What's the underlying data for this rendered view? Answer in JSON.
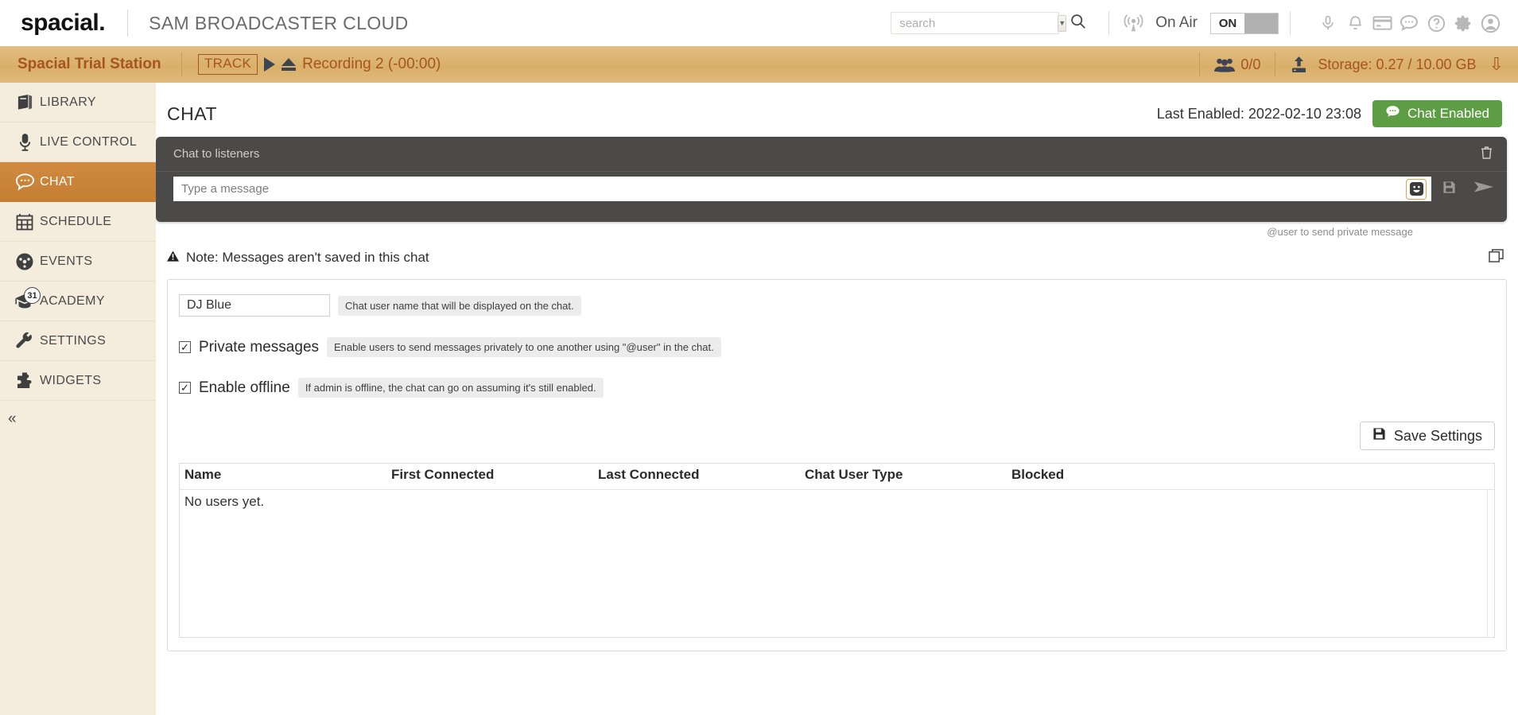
{
  "header": {
    "brand": "spacial",
    "brand_dot": ".",
    "product": "SAM BROADCASTER CLOUD",
    "search": {
      "value": "",
      "placeholder": "search"
    },
    "search_caret_icon": "chevron-down-icon",
    "search_icon": "search-icon",
    "onair": {
      "icon": "broadcast-tower-icon",
      "label": "On Air",
      "state": "ON"
    },
    "icons": [
      "microphone-icon",
      "bell-icon",
      "credit-card-icon",
      "chat-bubble-icon",
      "question-circle-icon",
      "gear-icon",
      "user-circle-icon"
    ]
  },
  "station_bar": {
    "station_name": "Spacial Trial Station",
    "track_tag": "TRACK",
    "track_title": "Recording 2 (-00:00)",
    "listeners": "0/0",
    "storage": "Storage: 0.27 / 10.00 GB",
    "expand_icon": "chevron-double-down-icon"
  },
  "sidebar": {
    "items": [
      {
        "label": "LIBRARY",
        "icon": "book-icon",
        "active": false
      },
      {
        "label": "LIVE CONTROL",
        "icon": "microphone-icon",
        "active": false
      },
      {
        "label": "CHAT",
        "icon": "chat-bubble-icon",
        "active": true
      },
      {
        "label": "SCHEDULE",
        "icon": "calendar-icon",
        "active": false
      },
      {
        "label": "EVENTS",
        "icon": "gauge-icon",
        "active": false
      },
      {
        "label": "ACADEMY",
        "icon": "graduation-cap-icon",
        "active": false,
        "badge": "31"
      },
      {
        "label": "SETTINGS",
        "icon": "wrench-icon",
        "active": false
      },
      {
        "label": "WIDGETS",
        "icon": "puzzle-icon",
        "active": false
      }
    ],
    "collapse_icon": "chevron-double-left-icon"
  },
  "main": {
    "page_title": "CHAT",
    "last_enabled": "Last Enabled: 2022-02-10 23:08",
    "chat_enabled_button": "Chat Enabled",
    "chat_enabled_icon": "chat-bubble-icon",
    "chat_enabled_color": "#5d9e45",
    "chat_panel": {
      "title": "Chat to listeners",
      "trash_icon": "trash-icon",
      "input_value": "",
      "input_placeholder": "Type a message",
      "emoji_icon": "smiley-icon",
      "save_icon": "floppy-disk-icon",
      "send_icon": "send-icon",
      "hint": "@user to send private message"
    },
    "note": "Note: Messages aren't saved in this chat",
    "note_icon": "warning-triangle-icon",
    "popout_icon": "popout-window-icon",
    "settings": {
      "username_value": "DJ Blue",
      "username_help": "Chat user name that will be displayed on the chat.",
      "private_messages": {
        "label": "Private messages",
        "checked": true,
        "help": "Enable users to send messages privately to one another using \"@user\" in the chat."
      },
      "enable_offline": {
        "label": "Enable offline",
        "checked": true,
        "help": "If admin is offline, the chat can go on assuming it's still enabled."
      },
      "save_button": "Save Settings",
      "save_icon": "floppy-disk-icon"
    },
    "users_table": {
      "columns": [
        "Name",
        "First Connected",
        "Last Connected",
        "Chat User Type",
        "Blocked"
      ],
      "empty_text": "No users yet.",
      "rows": []
    }
  }
}
